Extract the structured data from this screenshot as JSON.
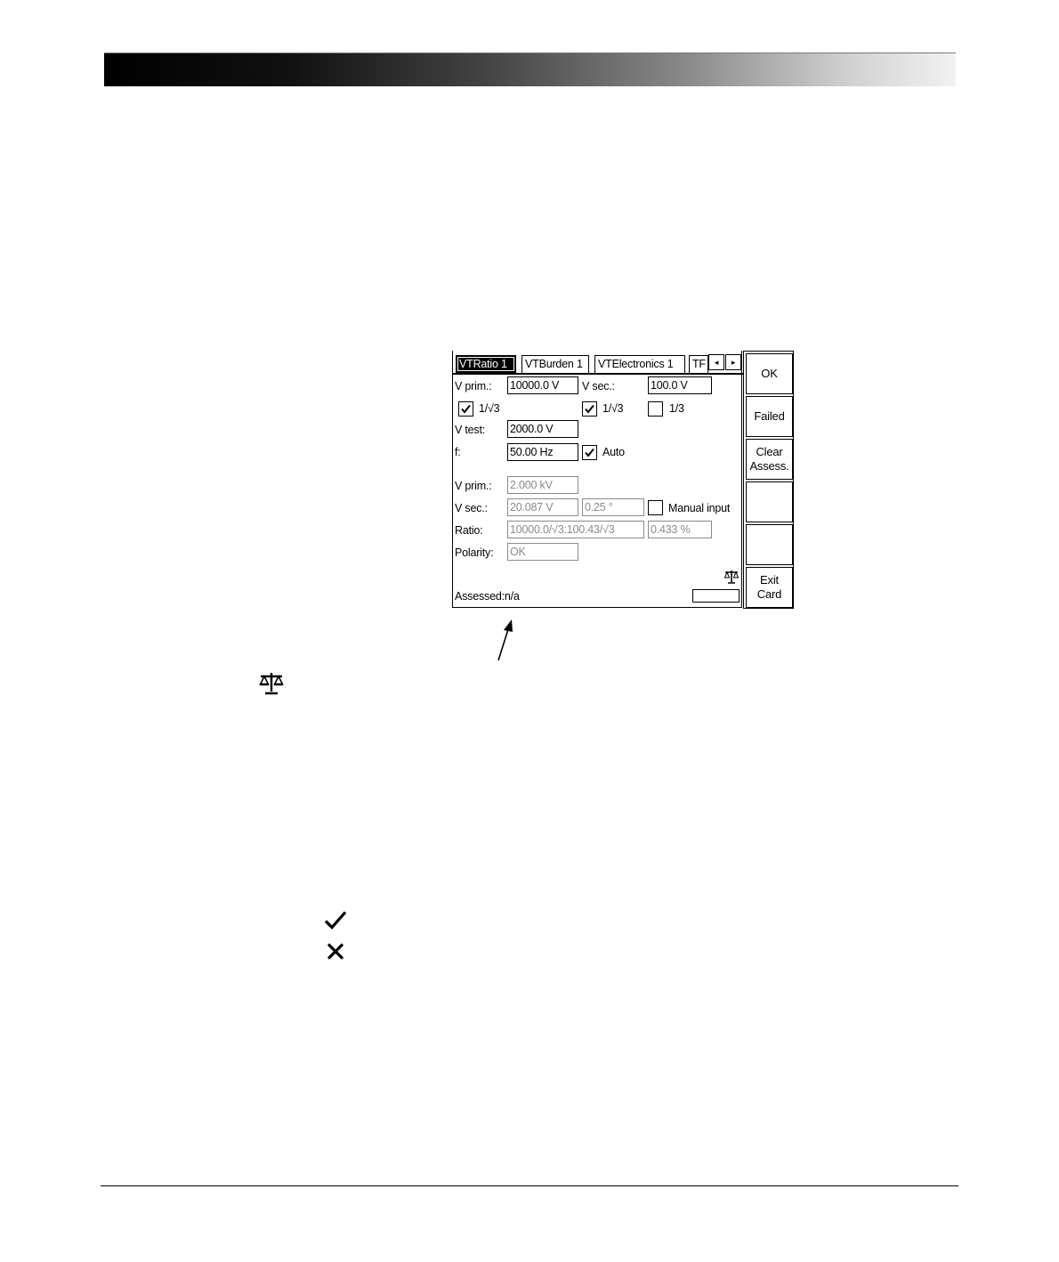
{
  "tabs": [
    {
      "label": "VTRatio 1",
      "active": true
    },
    {
      "label": "VTBurden 1",
      "active": false
    },
    {
      "label": "VTElectronics 1",
      "active": false
    },
    {
      "label": "TF",
      "active": false
    }
  ],
  "settings": {
    "vprim_label": "V prim.:",
    "vprim_value": "10000.0 V",
    "vsec_label": "V sec.:",
    "vsec_value": "100.0 V",
    "cb_prim_sqrt3_label": "1/√3",
    "cb_sec_sqrt3_label": "1/√3",
    "cb_third_label": "1/3",
    "vtest_label": "V test:",
    "vtest_value": "2000.0 V",
    "f_label": "f:",
    "f_value": "50.00 Hz",
    "auto_label": "Auto"
  },
  "checkbox_states": {
    "prim_sqrt3": true,
    "sec_sqrt3": true,
    "third": false,
    "auto": true,
    "manual_input": false
  },
  "results": {
    "vprim_label": "V prim.:",
    "vprim_value": "2.000 kV",
    "vsec_label": "V sec.:",
    "vsec_value": "20.087 V",
    "vsec_phase": "0.25 °",
    "manual_input_label": "Manual input",
    "ratio_label": "Ratio:",
    "ratio_value": "10000.0/√3:100.43/√3",
    "ratio_error": "0.433 %",
    "polarity_label": "Polarity:",
    "polarity_value": "OK"
  },
  "status": {
    "assessed": "Assessed:n/a"
  },
  "side_buttons": [
    {
      "label": "OK"
    },
    {
      "label": "Failed"
    },
    {
      "label": "Clear\nAssess."
    },
    {
      "label": ""
    },
    {
      "label": ""
    },
    {
      "label": "Exit\nCard"
    }
  ],
  "icons": {
    "scale": "scale-icon",
    "check": "check-icon",
    "cross": "cross-icon",
    "tab_left": "◂",
    "tab_right": "▸"
  }
}
